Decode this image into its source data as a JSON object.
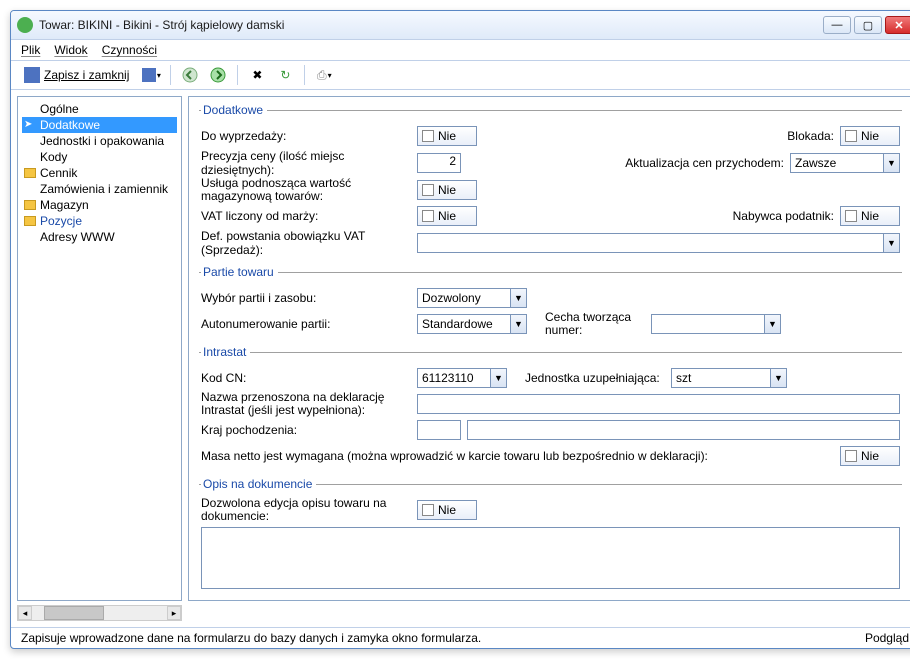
{
  "window": {
    "title": "Towar: BIKINI - Bikini - Strój kąpielowy damski"
  },
  "menu": {
    "plik": "Plik",
    "widok": "Widok",
    "czynnosci": "Czynności"
  },
  "toolbar": {
    "save_close": "Zapisz i zamknij"
  },
  "nav": {
    "ogolne": "Ogólne",
    "dodatkowe": "Dodatkowe",
    "jednostki": "Jednostki i opakowania",
    "kody": "Kody",
    "cennik": "Cennik",
    "zamowienia": "Zamówienia i zamiennik",
    "magazyn": "Magazyn",
    "pozycje": "Pozycje",
    "adresy": "Adresy WWW"
  },
  "dodatkowe": {
    "legend": "Dodatkowe",
    "do_wyprzedazy_lbl": "Do wyprzedaży:",
    "do_wyprzedazy": "Nie",
    "blokada_lbl": "Blokada:",
    "blokada": "Nie",
    "precyzja_lbl": "Precyzja ceny (ilość miejsc dziesiętnych):",
    "precyzja_val": "2",
    "aktualizacja_lbl": "Aktualizacja cen przychodem:",
    "aktualizacja_val": "Zawsze",
    "usluga_lbl": "Usługa podnosząca wartość magazynową towarów:",
    "usluga": "Nie",
    "vat_marza_lbl": "VAT liczony od marży:",
    "vat_marza": "Nie",
    "nabywca_lbl": "Nabywca podatnik:",
    "nabywca": "Nie",
    "def_vat_lbl": "Def. powstania obowiązku VAT (Sprzedaż):",
    "def_vat_val": ""
  },
  "partie": {
    "legend": "Partie towaru",
    "wybor_lbl": "Wybór partii i zasobu:",
    "wybor_val": "Dozwolony",
    "autonum_lbl": "Autonumerowanie partii:",
    "autonum_val": "Standardowe",
    "cecha_lbl": "Cecha tworząca numer:",
    "cecha_val": ""
  },
  "intrastat": {
    "legend": "Intrastat",
    "kodcn_lbl": "Kod CN:",
    "kodcn_val": "61123110",
    "jedn_lbl": "Jednostka uzupełniająca:",
    "jedn_val": "szt",
    "nazwa_lbl": "Nazwa przenoszona na deklarację Intrastat (jeśli jest wypełniona):",
    "nazwa_val": "",
    "kraj_lbl": "Kraj pochodzenia:",
    "kraj_code": "",
    "kraj_name": "",
    "masa_lbl": "Masa netto jest wymagana (można wprowadzić w karcie towaru lub bezpośrednio w deklaracji):",
    "masa": "Nie"
  },
  "opis": {
    "legend": "Opis na dokumencie",
    "dozw_lbl": "Dozwolona edycja opisu towaru na dokumencie:",
    "dozw": "Nie",
    "text": ""
  },
  "status": {
    "hint": "Zapisuje wprowadzone dane na formularzu do bazy danych i zamyka okno formularza.",
    "podglad": "Podgląd"
  }
}
